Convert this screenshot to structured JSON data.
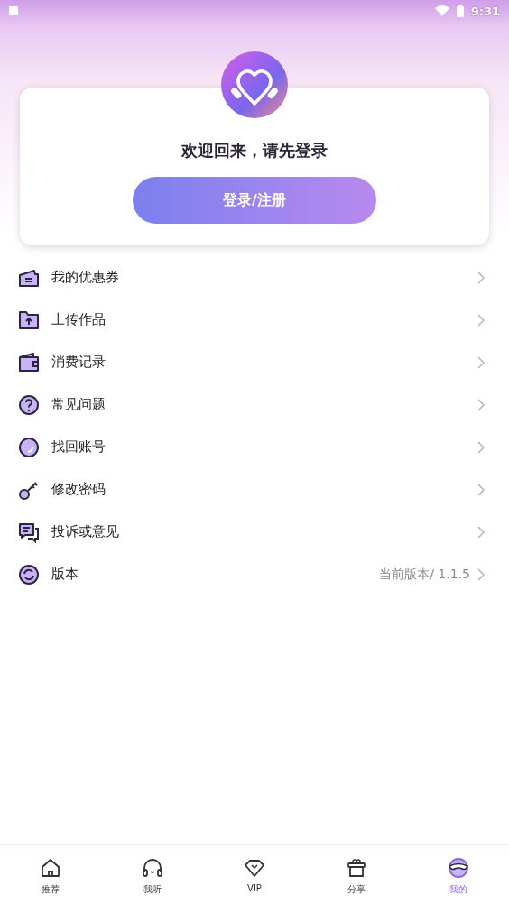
{
  "status_bar": {
    "time": "9:31"
  },
  "login_card": {
    "title": "欢迎回来，请先登录",
    "button": "登录/注册"
  },
  "menu": [
    {
      "kind": "coupon",
      "label": "我的优惠券"
    },
    {
      "kind": "upload",
      "label": "上传作品"
    },
    {
      "kind": "wallet",
      "label": "消费记录"
    },
    {
      "kind": "question",
      "label": "常见问题"
    },
    {
      "kind": "account",
      "label": "找回账号"
    },
    {
      "kind": "key",
      "label": "修改密码"
    },
    {
      "kind": "feedback",
      "label": "投诉或意见"
    },
    {
      "kind": "version",
      "label": "版本",
      "value": "当前版本/ 1.1.5"
    }
  ],
  "tab_bar": [
    {
      "kind": "home",
      "label": "推荐",
      "selected": false
    },
    {
      "kind": "headphones",
      "label": "我听",
      "selected": false
    },
    {
      "kind": "diamond",
      "label": "VIP",
      "selected": false
    },
    {
      "kind": "gift",
      "label": "分享",
      "selected": false
    },
    {
      "kind": "profile",
      "label": "我的",
      "selected": true
    }
  ]
}
